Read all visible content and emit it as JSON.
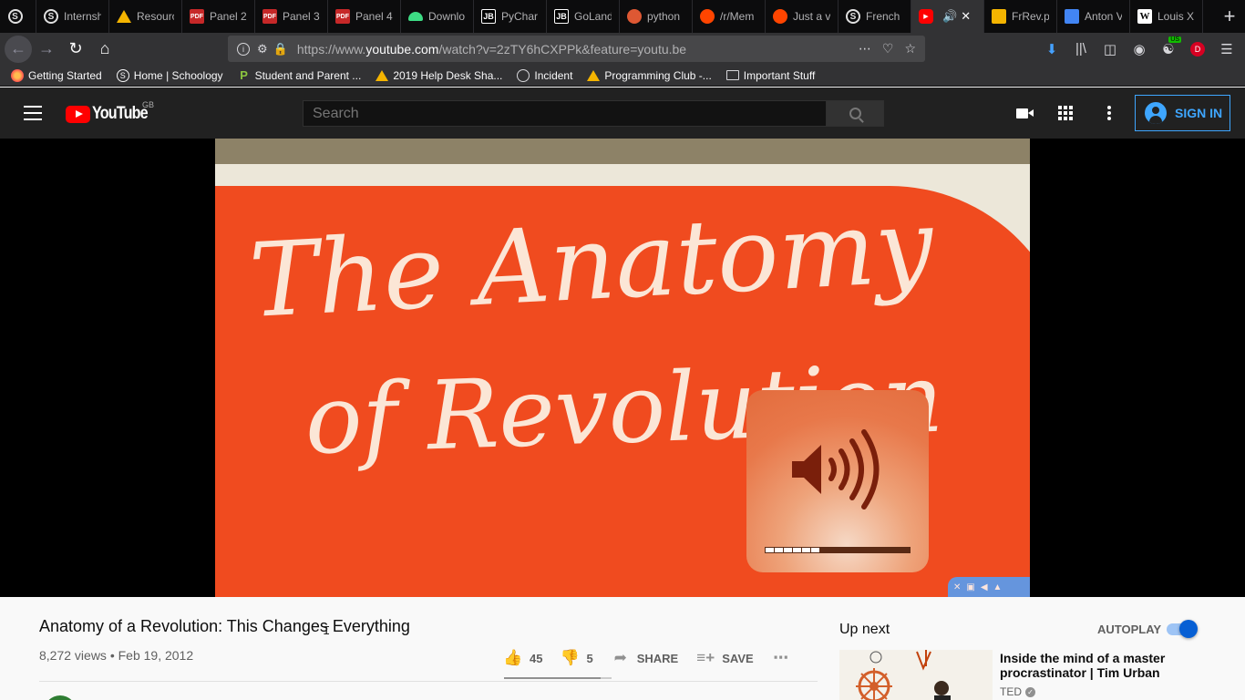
{
  "browser": {
    "tabs": [
      {
        "label": "",
        "icon": "schoology-icon"
      },
      {
        "label": "Internshi",
        "icon": "schoology-icon"
      },
      {
        "label": "Resourc",
        "icon": "google-drive-icon"
      },
      {
        "label": "Panel 2",
        "icon": "pdf-icon"
      },
      {
        "label": "Panel 3",
        "icon": "pdf-icon"
      },
      {
        "label": "Panel 4",
        "icon": "pdf-icon"
      },
      {
        "label": "Downlo",
        "icon": "android-icon"
      },
      {
        "label": "PyChar",
        "icon": "jetbrains-icon"
      },
      {
        "label": "GoLand",
        "icon": "jetbrains-icon"
      },
      {
        "label": "python",
        "icon": "duckduckgo-icon"
      },
      {
        "label": "/r/Mem",
        "icon": "reddit-icon"
      },
      {
        "label": "Just a v",
        "icon": "reddit-icon"
      },
      {
        "label": "French",
        "icon": "schoology-icon"
      },
      {
        "label": "",
        "icon": "youtube-icon",
        "active": true
      },
      {
        "label": "FrRev.p",
        "icon": "google-slides-icon"
      },
      {
        "label": "Anton V",
        "icon": "google-docs-icon"
      },
      {
        "label": "Louis X",
        "icon": "wikipedia-icon"
      }
    ],
    "fav_text": {
      "pdf": "PDF",
      "jb": "JB",
      "yt": "▶",
      "wiki": "W",
      "s": "S"
    },
    "url": {
      "prefix": "https://www.",
      "host": "youtube.com",
      "path": "/watch?v=2zTY6hCXPPk&feature=youtu.be"
    },
    "bookmarks": [
      {
        "label": "Getting Started",
        "icon": "firefox-icon"
      },
      {
        "label": "Home | Schoology",
        "icon": "schoology-icon"
      },
      {
        "label": "Student and Parent ...",
        "icon": "powerschool-icon"
      },
      {
        "label": "2019 Help Desk Sha...",
        "icon": "google-drive-icon"
      },
      {
        "label": "Incident",
        "icon": "globe-icon"
      },
      {
        "label": "Programming Club -...",
        "icon": "google-drive-icon"
      },
      {
        "label": "Important Stuff",
        "icon": "folder-icon"
      }
    ],
    "addon_badge": "US",
    "profile_letter": "D"
  },
  "youtube": {
    "region": "GB",
    "search_placeholder": "Search",
    "signin_label": "SIGN IN"
  },
  "player": {
    "video_frame_text_line1": "The Anatomy",
    "video_frame_text_line2": "of Revolution",
    "volume_level": 0.375
  },
  "video": {
    "title": "Anatomy of a Revolution: This Changes Everything",
    "meta": "8,272 views • Feb 19, 2012",
    "likes": "45",
    "dislikes": "5",
    "like_ratio": 0.9,
    "share_label": "SHARE",
    "save_label": "SAVE"
  },
  "sidebar": {
    "up_next": "Up next",
    "autoplay_label": "AUTOPLAY",
    "autoplay_on": true,
    "recommendation": {
      "title": "Inside the mind of a master procrastinator | Tim Urban",
      "channel": "TED"
    }
  },
  "colors": {
    "youtube_red": "#ff0000",
    "link_blue": "#3ea6ff",
    "toggle_blue": "#065fd4",
    "frame_orange": "#f04b1f"
  }
}
